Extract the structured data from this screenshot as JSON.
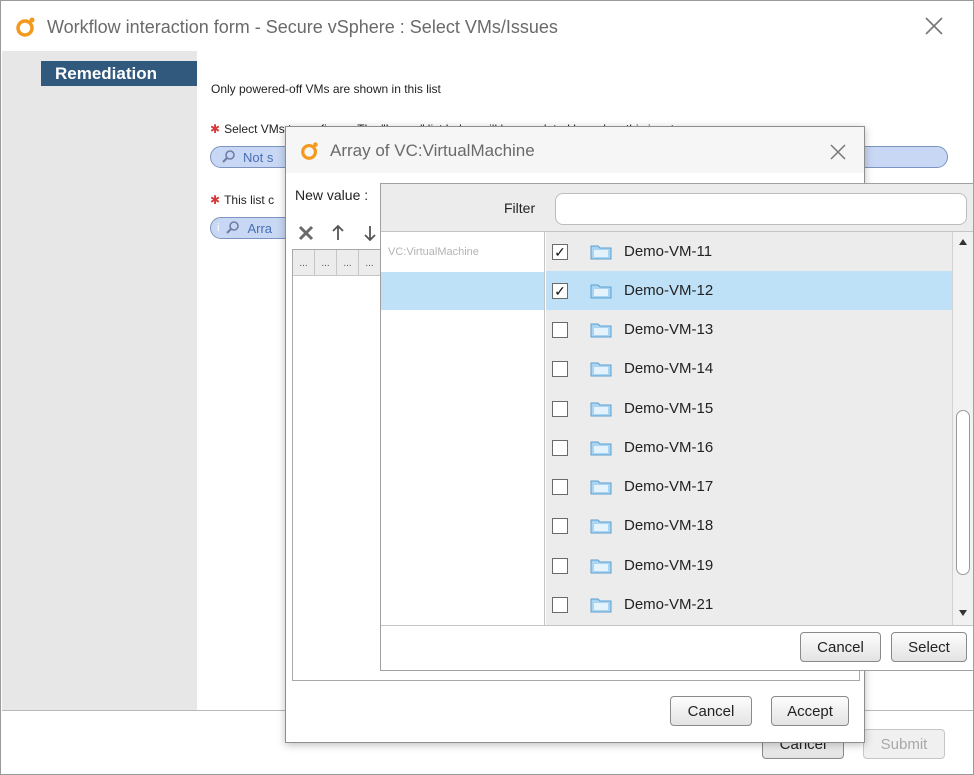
{
  "main_window": {
    "title": "Workflow interaction form - Secure vSphere : Select VMs/Issues",
    "section": "Remediation",
    "info": "Only powered-off VMs are shown in this list",
    "field1_label": "Select VMs to configure. The \"Issues\" list below will be populated based on this input",
    "field1_value": "Not s",
    "field2_label": "This list c",
    "field2_value": "Arra",
    "cancel_label": "Cancel",
    "submit_label": "Submit"
  },
  "array_dialog": {
    "title": "Array of VC:VirtualMachine",
    "new_value_label": "New value :",
    "header_cells": [
      "...",
      "...",
      "...",
      "...",
      "..."
    ],
    "cancel_label": "Cancel",
    "accept_label": "Accept"
  },
  "chooser": {
    "filter_label": "Filter",
    "filter_value": "",
    "tree_root": "VC:VirtualMachine",
    "vms": [
      {
        "name": "Demo-VM-11",
        "checked": true,
        "check": "✓"
      },
      {
        "name": "Demo-VM-12",
        "checked": true,
        "check": "✓"
      },
      {
        "name": "Demo-VM-13",
        "checked": false,
        "check": ""
      },
      {
        "name": "Demo-VM-14",
        "checked": false,
        "check": ""
      },
      {
        "name": "Demo-VM-15",
        "checked": false,
        "check": ""
      },
      {
        "name": "Demo-VM-16",
        "checked": false,
        "check": ""
      },
      {
        "name": "Demo-VM-17",
        "checked": false,
        "check": ""
      },
      {
        "name": "Demo-VM-18",
        "checked": false,
        "check": ""
      },
      {
        "name": "Demo-VM-19",
        "checked": false,
        "check": ""
      },
      {
        "name": "Demo-VM-21",
        "checked": false,
        "check": ""
      }
    ],
    "cancel_label": "Cancel",
    "select_label": "Select"
  },
  "colors": {
    "section_tab": "#31597d",
    "selection": "#bfe1f7",
    "logo_orange": "#f39a1e",
    "required_star": "#d43a3a"
  }
}
